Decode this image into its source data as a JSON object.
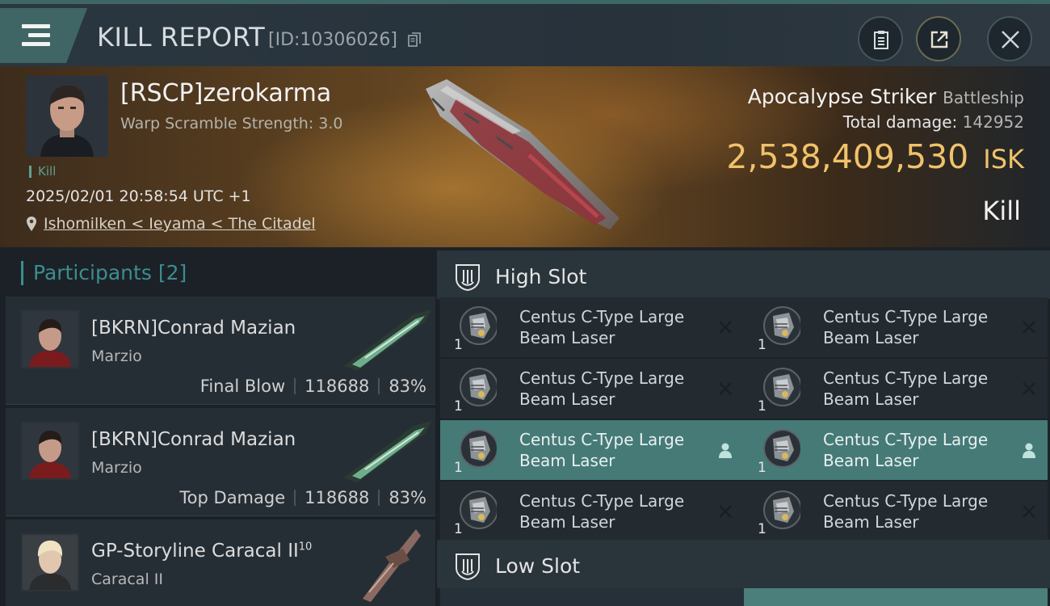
{
  "header": {
    "title": "KILL REPORT",
    "report_id": "[ID:10306026]"
  },
  "victim": {
    "name": "[RSCP]zerokarma",
    "subtitle": "Warp Scramble Strength: 3.0",
    "tag": "Kill",
    "time": "2025/02/01 20:58:54 UTC +1",
    "location": "Ishomilken < Ieyama < The Citadel",
    "ship_name": "Apocalypse Striker",
    "ship_class": "Battleship",
    "damage_label": "Total damage:",
    "damage_value": "142952",
    "isk_value": "2,538,409,530",
    "isk_unit": "ISK",
    "result": "Kill"
  },
  "participants": {
    "label": "Participants",
    "count": "[2]",
    "items": [
      {
        "name": "[BKRN]Conrad Mazian",
        "ship": "Marzio",
        "role": "Final Blow",
        "damage": "118688",
        "percent": "83%"
      },
      {
        "name": "[BKRN]Conrad Mazian",
        "ship": "Marzio",
        "role": "Top Damage",
        "damage": "118688",
        "percent": "83%"
      },
      {
        "name": "GP-Storyline Caracal II",
        "level": "10",
        "ship": "Caracal II"
      }
    ]
  },
  "high_slot": {
    "label": "High Slot",
    "modules": [
      {
        "line1": "Centus C-Type Large",
        "line2": "Beam Laser",
        "qty": "1",
        "state": "destroyed"
      },
      {
        "line1": "Centus C-Type Large",
        "line2": "Beam Laser",
        "qty": "1",
        "state": "destroyed"
      },
      {
        "line1": "Centus C-Type Large",
        "line2": "Beam Laser",
        "qty": "1",
        "state": "destroyed"
      },
      {
        "line1": "Centus C-Type Large",
        "line2": "Beam Laser",
        "qty": "1",
        "state": "destroyed"
      },
      {
        "line1": "Centus C-Type Large",
        "line2": "Beam Laser",
        "qty": "1",
        "state": "dropped"
      },
      {
        "line1": "Centus C-Type Large",
        "line2": "Beam Laser",
        "qty": "1",
        "state": "dropped"
      },
      {
        "line1": "Centus C-Type Large",
        "line2": "Beam Laser",
        "qty": "1",
        "state": "destroyed"
      },
      {
        "line1": "Centus C-Type Large",
        "line2": "Beam Laser",
        "qty": "1",
        "state": "destroyed"
      }
    ]
  },
  "low_slot": {
    "label": "Low Slot"
  },
  "colors": {
    "accent_teal": "#3d8d8f",
    "isk_gold": "#f0c26a",
    "active_row": "#457a77"
  },
  "icons": [
    "menu-icon",
    "copy-icon",
    "clipboard-icon",
    "share-icon",
    "close-icon",
    "location-pin-icon",
    "high-slot-icon",
    "low-slot-icon",
    "laser-module-icon",
    "destroyed-x-icon",
    "dropped-person-icon"
  ]
}
